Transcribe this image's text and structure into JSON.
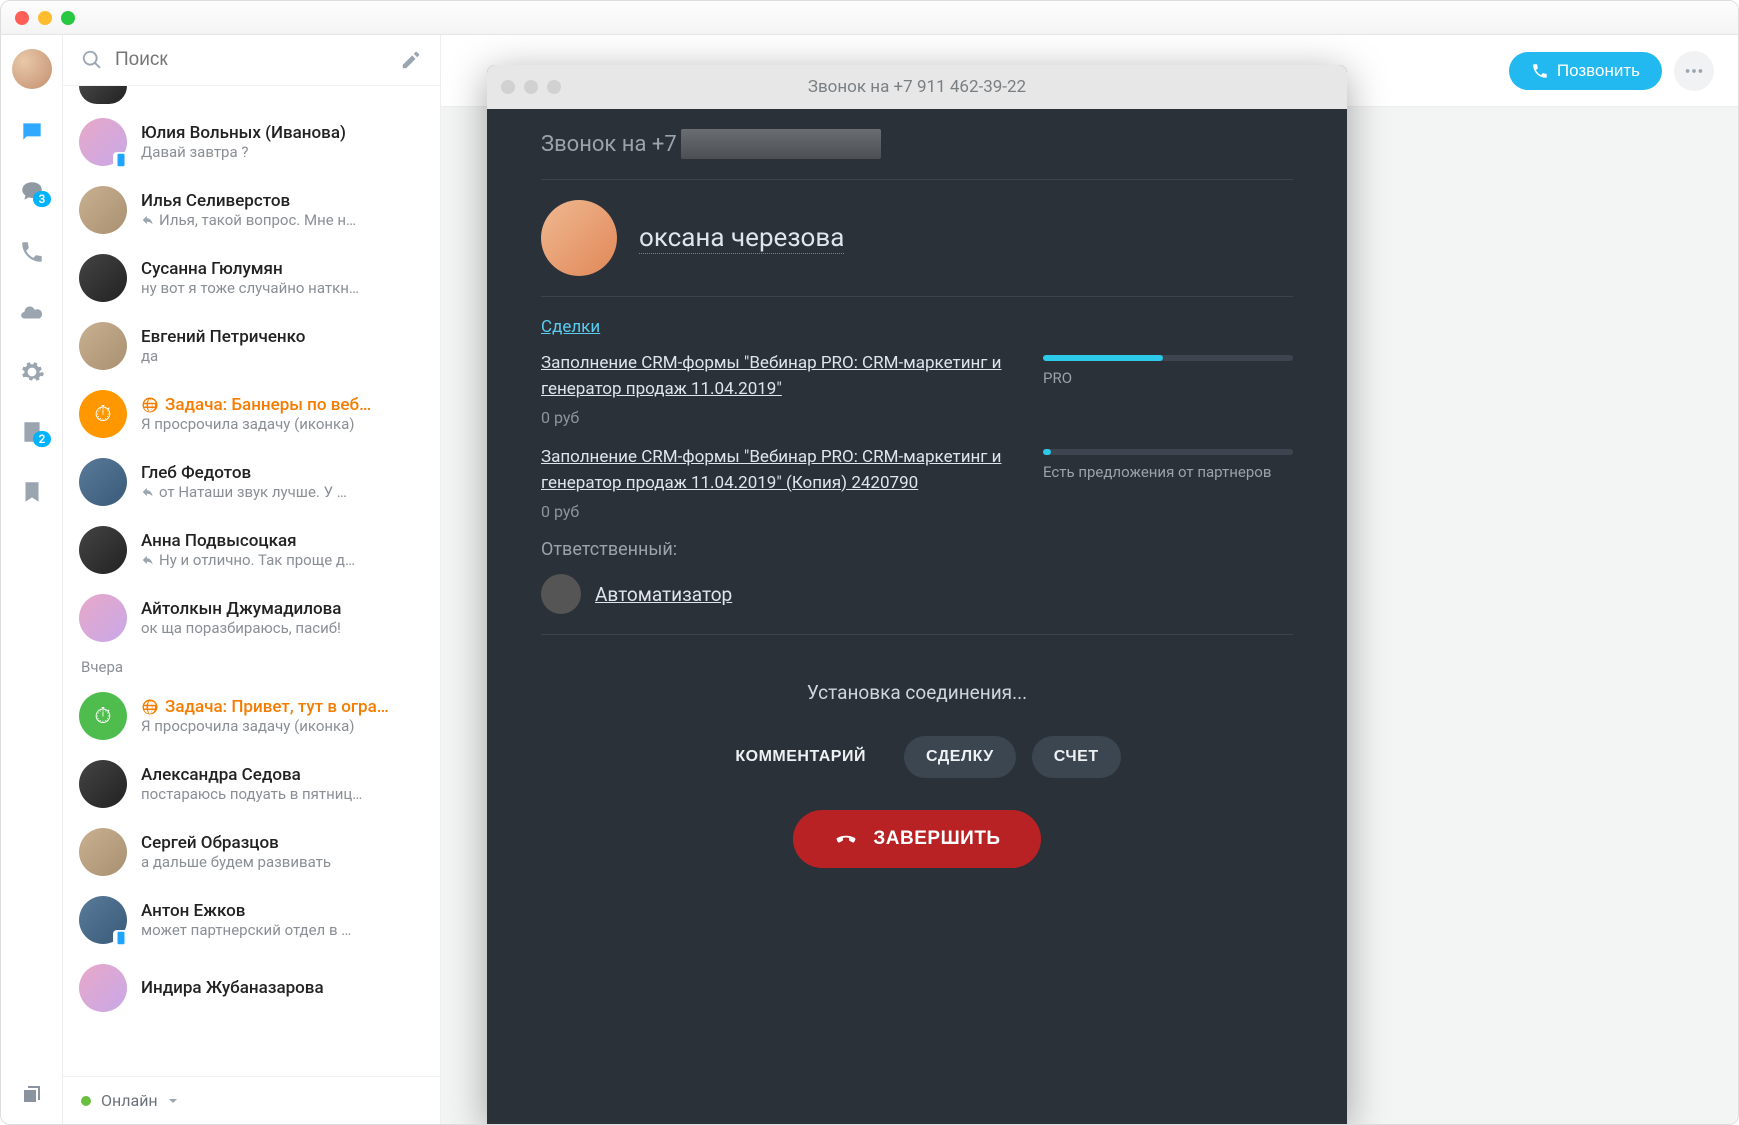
{
  "search": {
    "placeholder": "Поиск"
  },
  "rail": {
    "contacts_badge": "3",
    "forms_badge": "2"
  },
  "chats": {
    "items": [
      {
        "name": "Юлия Вольных (Иванова)",
        "sub": "Давай завтра ?",
        "reply": false,
        "task": false,
        "av": "p",
        "mob": true
      },
      {
        "name": "Илья Селиверстов",
        "sub": "Илья, такой вопрос. Мне н…",
        "reply": true,
        "task": false,
        "av": "br",
        "mob": false
      },
      {
        "name": "Сусанна Гюлумян",
        "sub": "ну вот я тоже случайно наткн…",
        "reply": false,
        "task": false,
        "av": "d",
        "mob": false
      },
      {
        "name": "Евгений Петриченко",
        "sub": "да",
        "reply": false,
        "task": false,
        "av": "br",
        "mob": false
      },
      {
        "name": "Задача: Баннеры по веб…",
        "sub": "Я просрочила задачу (иконка)",
        "reply": false,
        "task": true,
        "av": "o",
        "mob": false
      },
      {
        "name": "Глеб Федотов",
        "sub": "от Наташи звук лучше. У …",
        "reply": true,
        "task": false,
        "av": "b",
        "mob": false
      },
      {
        "name": "Анна Подвысоцкая",
        "sub": "Ну и отлично. Так проще д…",
        "reply": true,
        "task": false,
        "av": "d",
        "mob": false
      },
      {
        "name": "Айтолкын Джумадилова",
        "sub": "ок ща поразбираюсь, пасиб!",
        "reply": false,
        "task": false,
        "av": "p",
        "mob": false
      }
    ],
    "section_label": "Вчера",
    "items2": [
      {
        "name": "Задача: Привет, тут в огра…",
        "sub": "Я просрочила задачу (иконка)",
        "reply": false,
        "task": true,
        "av": "g",
        "mob": false
      },
      {
        "name": "Александра Седова",
        "sub": "постараюсь подуать в пятниц…",
        "reply": false,
        "task": false,
        "av": "d",
        "mob": false
      },
      {
        "name": "Сергей Образцов",
        "sub": "а дальше будем развивать",
        "reply": false,
        "task": false,
        "av": "br",
        "mob": false
      },
      {
        "name": "Антон Ежков",
        "sub": "может партнерский отдел в …",
        "reply": false,
        "task": false,
        "av": "b",
        "mob": true
      },
      {
        "name": "Индира Жубаназарова",
        "sub": "",
        "reply": false,
        "task": false,
        "av": "p",
        "mob": false
      }
    ]
  },
  "status": {
    "label": "Онлайн"
  },
  "topbar": {
    "call_label": "Позвонить"
  },
  "modal": {
    "title": "Звонок на +7 911 462-39-22",
    "call_to": "Звонок на +7",
    "contact_name": "оксана черезова",
    "deals_label": "Сделки",
    "deals": [
      {
        "title": "Заполнение CRM-формы \"Вебинар PRO: CRM-маркетинг и генератор продаж 11.04.2019\"",
        "amount": "0 руб",
        "progress": 48,
        "stage": "PRO"
      },
      {
        "title": "Заполнение CRM-формы \"Вебинар PRO: CRM-маркетинг и генератор продаж 11.04.2019\" (Копия) 2420790",
        "amount": "0 руб",
        "progress": 3,
        "stage": "Есть предложения от партнеров"
      }
    ],
    "responsible_label": "Ответственный:",
    "responsible_name": "Автоматизатор",
    "connecting": "Установка соединения...",
    "actions": {
      "comment": "КОММЕНТАРИЙ",
      "deal": "СДЕЛКУ",
      "invoice": "СЧЕТ"
    },
    "end": "ЗАВЕРШИТЬ"
  }
}
